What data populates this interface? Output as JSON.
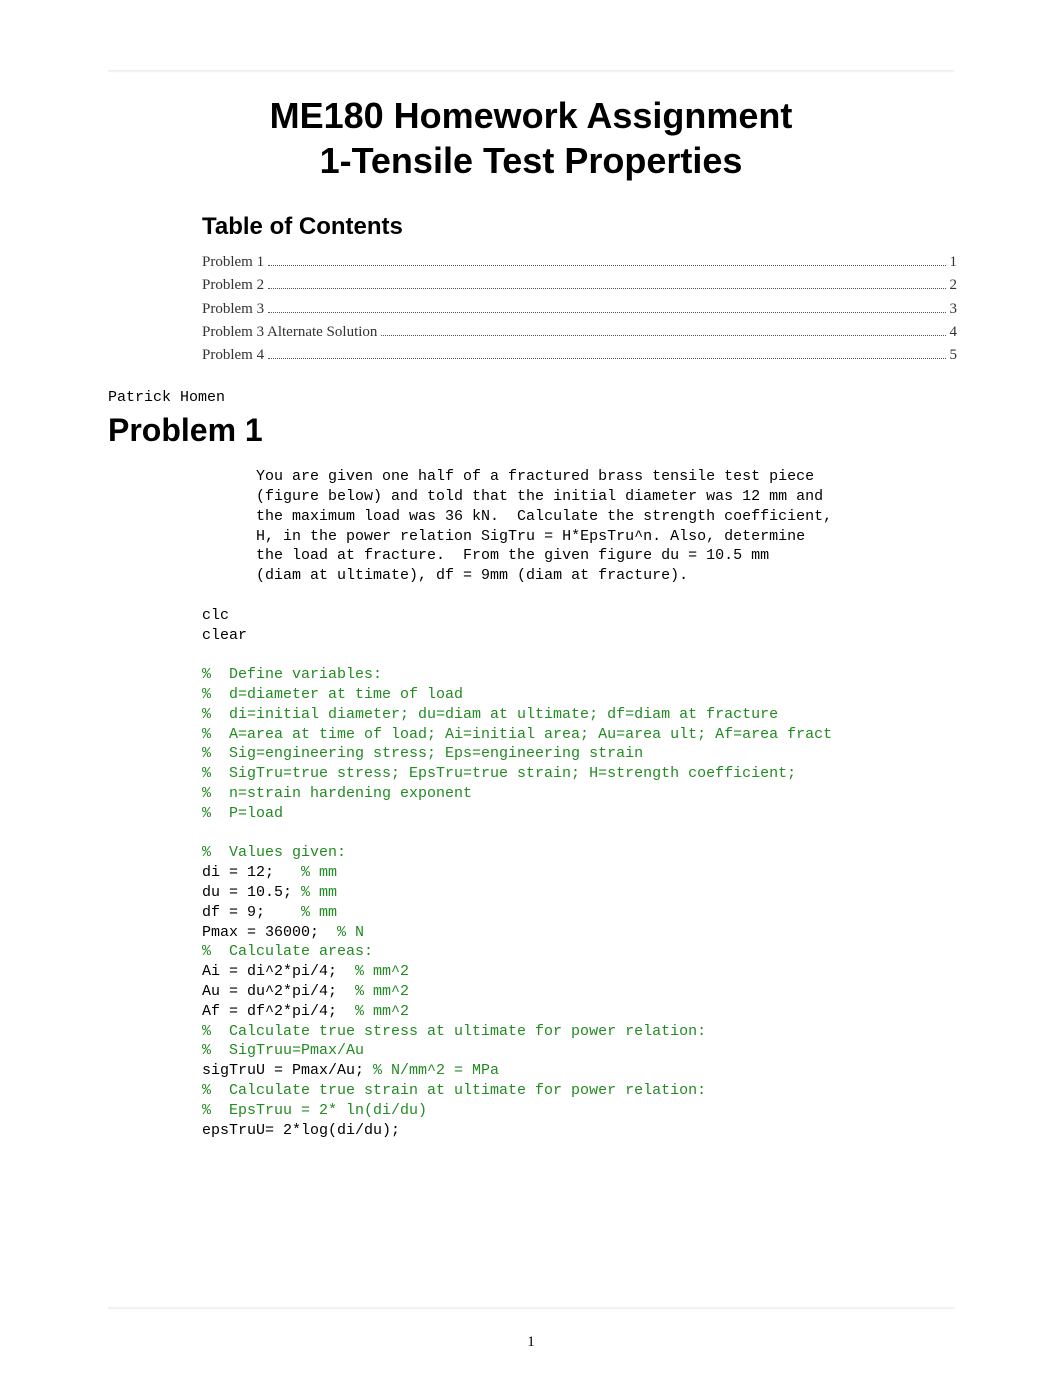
{
  "title_line1": "ME180 Homework Assignment",
  "title_line2": "1-Tensile Test Properties",
  "toc_title": "Table of Contents",
  "toc": [
    {
      "label": "Problem 1",
      "page": "1"
    },
    {
      "label": "Problem 2",
      "page": "2"
    },
    {
      "label": "Problem 3",
      "page": "3"
    },
    {
      "label": "Problem 3 Alternate Solution",
      "page": "4"
    },
    {
      "label": "Problem 4",
      "page": "5"
    }
  ],
  "author": "Patrick Homen",
  "section1_heading": "Problem 1",
  "code": {
    "intro": [
      "You are given one half of a fractured brass tensile test piece",
      "(figure below) and told that the initial diameter was 12 mm and",
      "the maximum load was 36 kN.  Calculate the strength coefficient,",
      "H, in the power relation SigTru = H*EpsTru^n. Also, determine",
      "the load at fracture.  From the given figure du = 10.5 mm",
      "(diam at ultimate), df = 9mm (diam at fracture)."
    ],
    "l_clc": "clc",
    "l_clear": "clear",
    "c_def": "%  Define variables:",
    "c_d": "%  d=diameter at time of load",
    "c_di": "%  di=initial diameter; du=diam at ultimate; df=diam at fracture",
    "c_A": "%  A=area at time of load; Ai=initial area; Au=area ult; Af=area fract",
    "c_Sig": "%  Sig=engineering stress; Eps=engineering strain",
    "c_SigTru": "%  SigTru=true stress; EpsTru=true strain; H=strength coefficient;",
    "c_n": "%  n=strain hardening exponent",
    "c_P": "%  P=load",
    "c_vals": "%  Values given:",
    "l_di_a": "di = 12;   ",
    "l_di_b": "% mm",
    "l_du_a": "du = 10.5; ",
    "l_du_b": "% mm",
    "l_df_a": "df = 9;    ",
    "l_df_b": "% mm",
    "l_Pmax_a": "Pmax = 36000;  ",
    "l_Pmax_b": "% N",
    "c_calcA": "%  Calculate areas:",
    "l_Ai_a": "Ai = di^2*pi/4;  ",
    "l_Ai_b": "% mm^2",
    "l_Au_a": "Au = du^2*pi/4;  ",
    "l_Au_b": "% mm^2",
    "l_Af_a": "Af = df^2*pi/4;  ",
    "l_Af_b": "% mm^2",
    "c_calcTSU": "%  Calculate true stress at ultimate for power relation:",
    "c_SigTruu": "%  SigTruu=Pmax/Au",
    "l_sigTruU_a": "sigTruU = Pmax/Au; ",
    "l_sigTruU_b": "% N/mm^2 = MPa",
    "c_calcTEU": "%  Calculate true strain at ultimate for power relation:",
    "c_EpsTruu": "%  EpsTruu = 2* ln(di/du)",
    "l_epsTruU": "epsTruU= 2*log(di/du);"
  },
  "page_number": "1"
}
